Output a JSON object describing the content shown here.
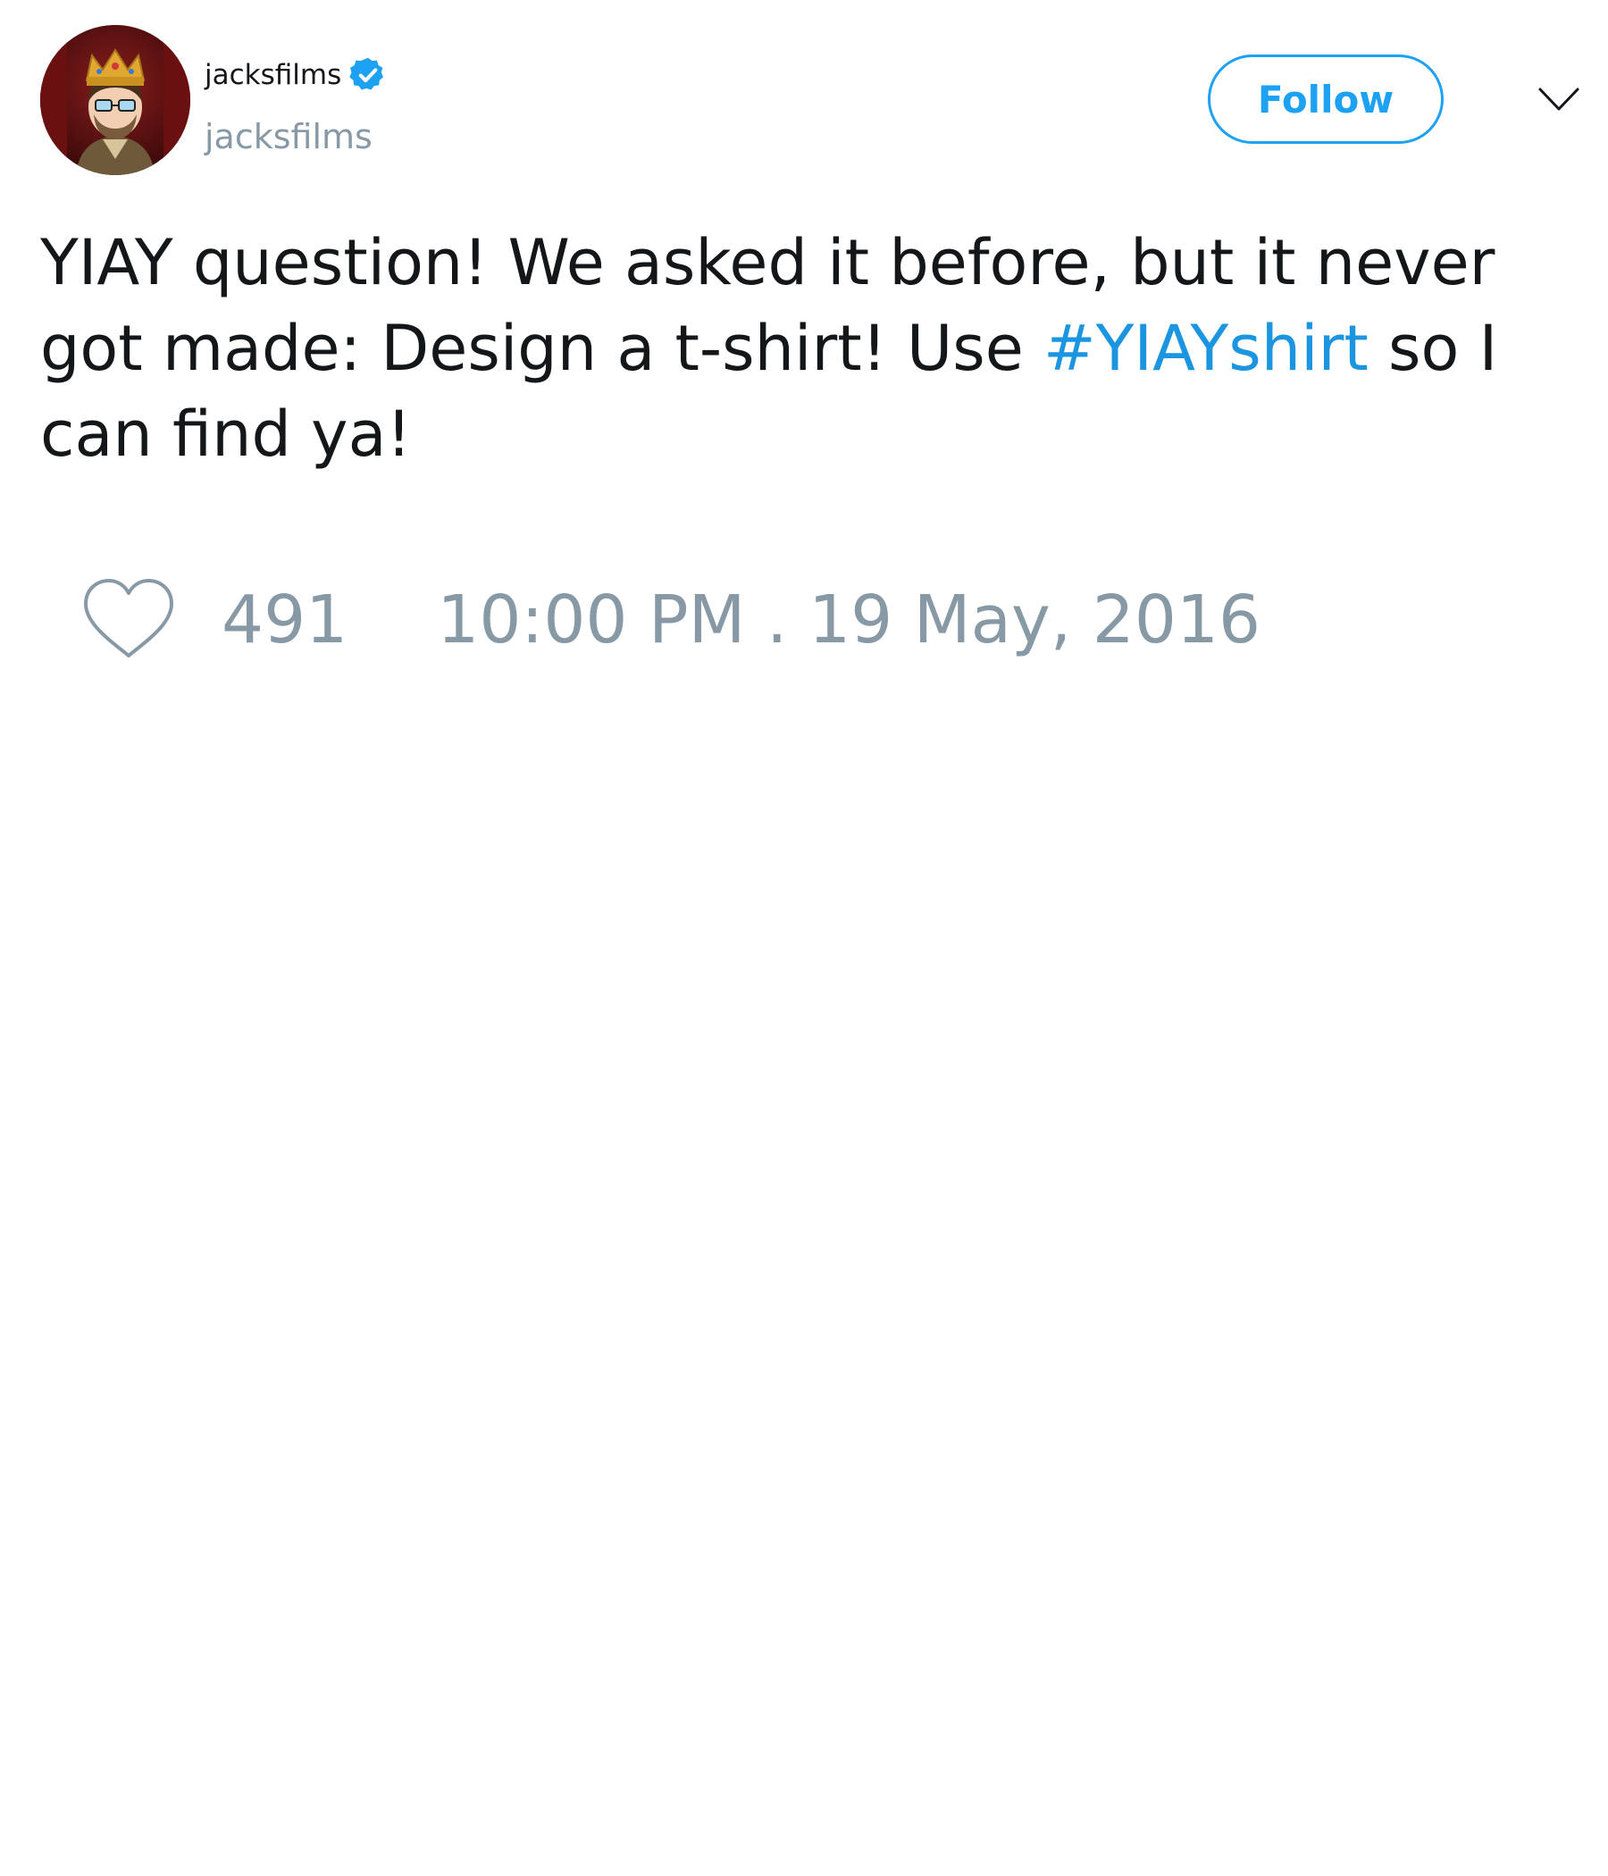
{
  "tweet": {
    "author": {
      "display_name": "jacksfilms",
      "handle": "jacksfilms",
      "verified": true,
      "avatar_icon": "avatar-king-cartoon"
    },
    "follow_label": "Follow",
    "menu_icon": "chevron-down-icon",
    "text": {
      "part1": "YIAY question! We asked it before, but it never got made: Design a t-shirt! Use ",
      "hashtag": "#YIAYshirt",
      "part2": " so I can find ya!"
    },
    "likes": "491",
    "timestamp": "10:00 PM . 19 May, 2016"
  },
  "colors": {
    "accent": "#1da1f2",
    "hashtag": "#1b95e0",
    "muted": "#8899a6",
    "text": "#14171a",
    "avatar_bg": "#5a1212"
  }
}
